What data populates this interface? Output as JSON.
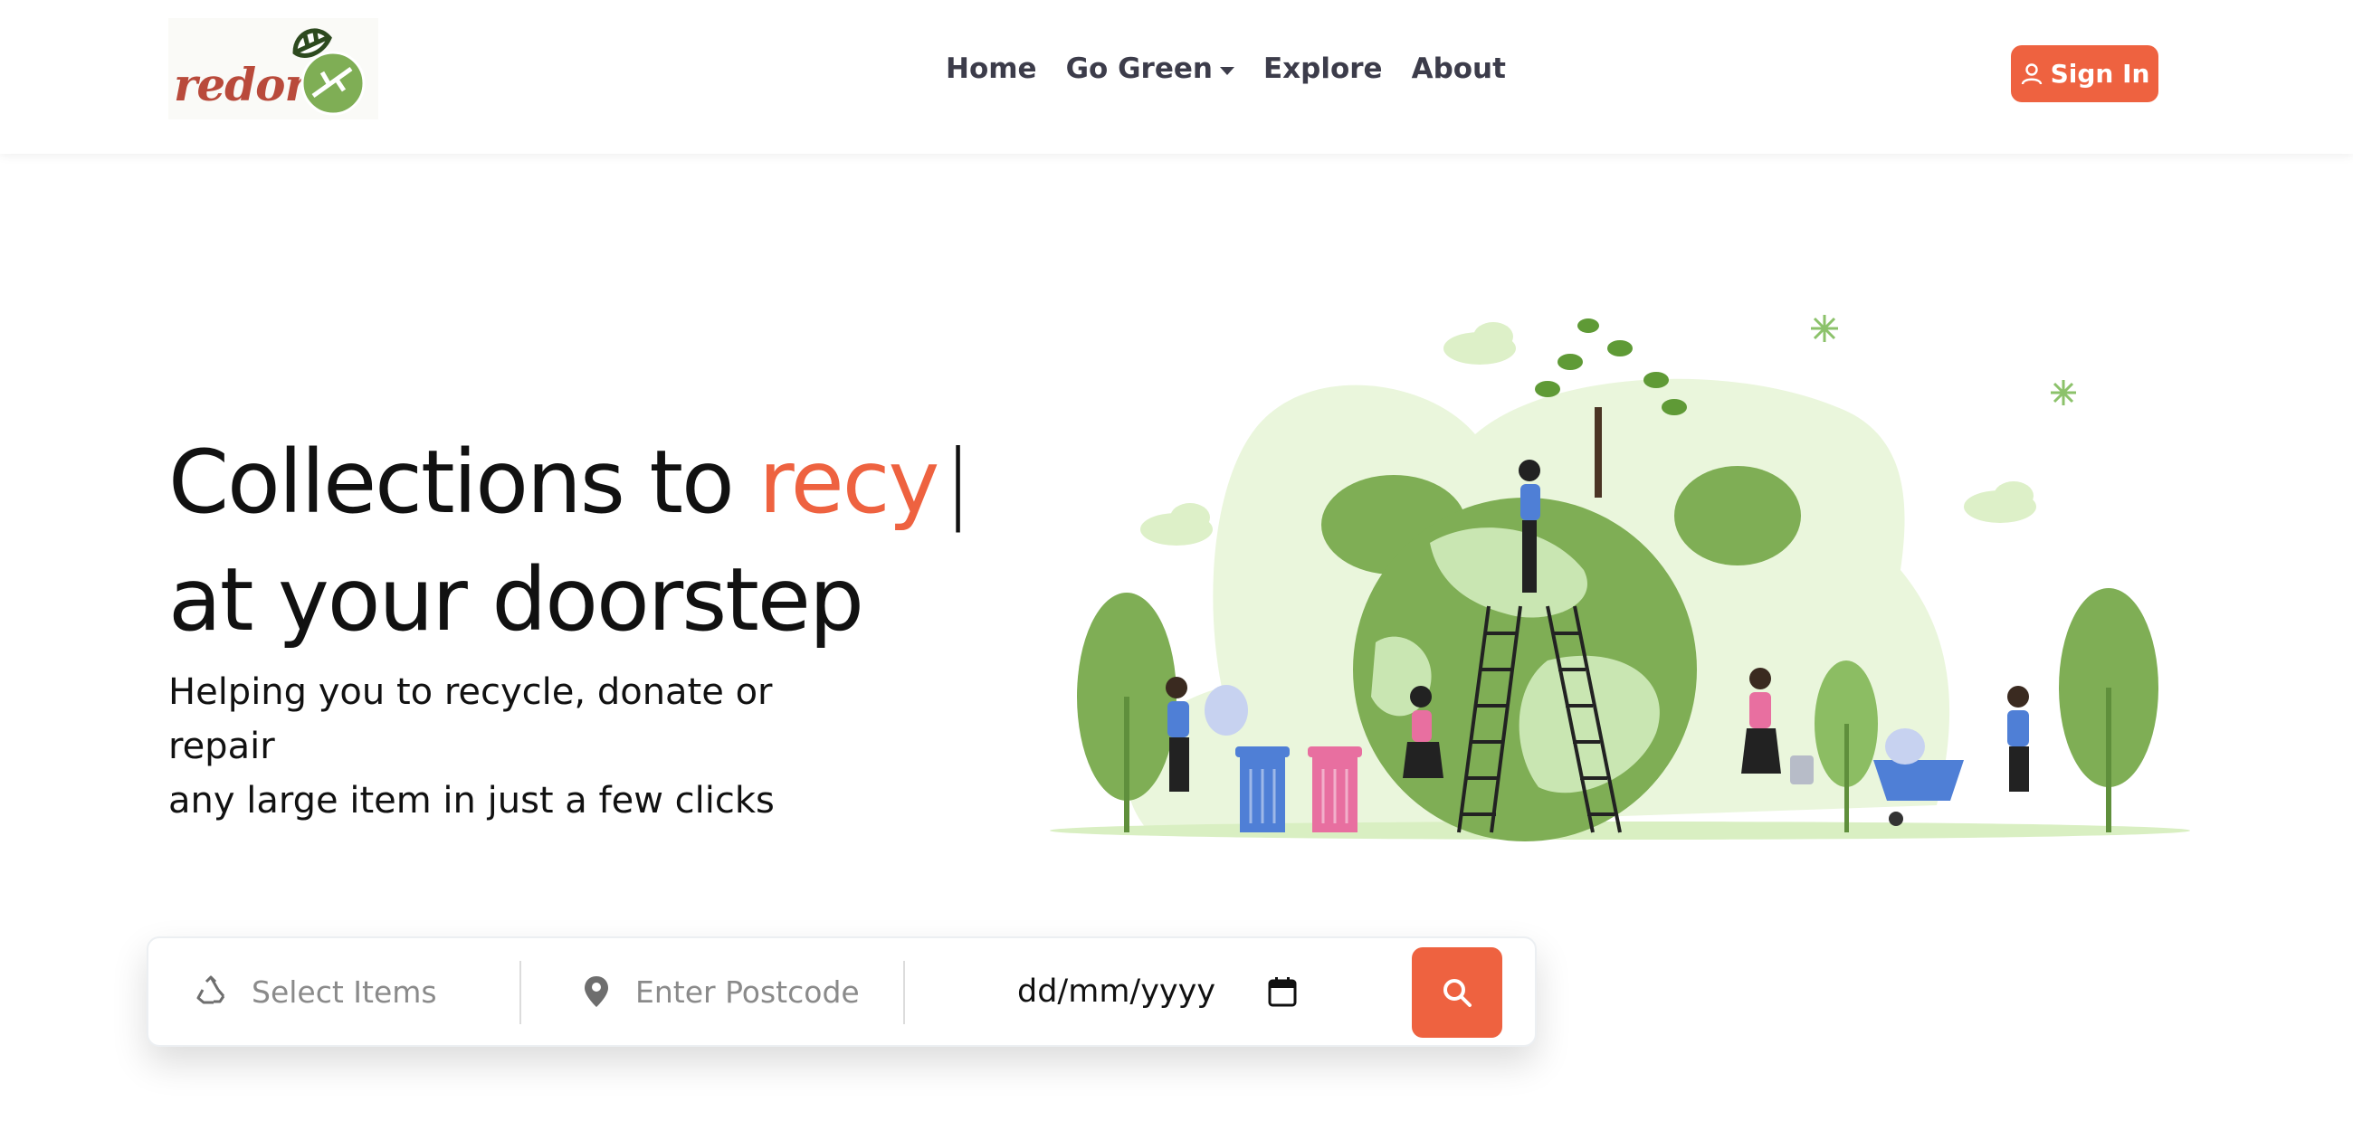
{
  "brand": {
    "logo_text": "redore"
  },
  "nav": {
    "items": [
      {
        "label": "Home"
      },
      {
        "label": "Go Green"
      },
      {
        "label": "Explore"
      },
      {
        "label": "About"
      }
    ],
    "signin_label": "Sign In"
  },
  "hero": {
    "title_prefix": "Collections to ",
    "title_accent": "recy",
    "title_cursor": "|",
    "title_line2": "at your doorstep",
    "subtitle_line1": "Helping you to recycle, donate or repair",
    "subtitle_line2": "any large item in just a few clicks"
  },
  "search": {
    "items_placeholder": "Select Items",
    "postcode_placeholder": "Enter Postcode",
    "date_value": "dd/mm/yyyy"
  },
  "colors": {
    "accent": "#ee6240",
    "nav_text": "#3c3c4a",
    "green": "#7fae55"
  },
  "icons": [
    "person-icon",
    "recycle-icon",
    "location-pin-icon",
    "calendar-icon",
    "search-icon",
    "chevron-down-icon"
  ]
}
